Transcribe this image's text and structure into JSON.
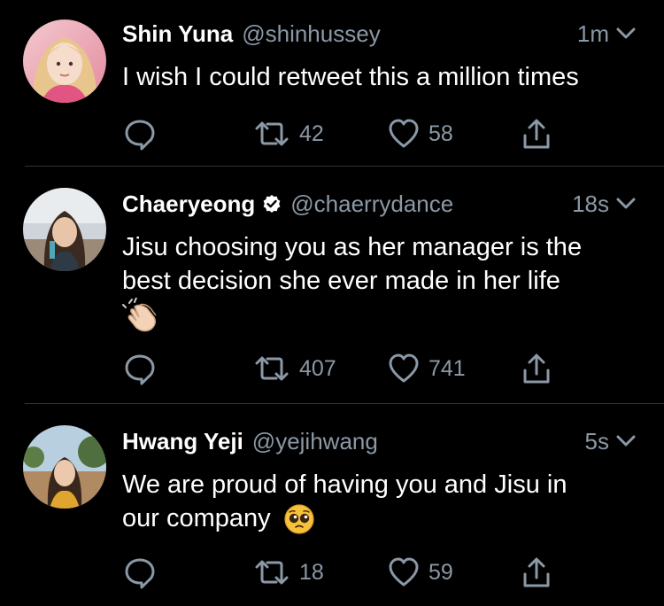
{
  "tweets": [
    {
      "name": "Shin Yuna",
      "handle": "@shinhussey",
      "time": "1m",
      "verified": false,
      "text": "I wish I could retweet this a million times",
      "retweets": "42",
      "likes": "58"
    },
    {
      "name": "Chaeryeong",
      "handle": "@chaerrydance",
      "time": "18s",
      "verified": true,
      "text_line1": "Jisu choosing you as her manager is the",
      "text_line2": "best decision she ever made in her life",
      "emoji": "clapping-hands",
      "retweets": "407",
      "likes": "741"
    },
    {
      "name": "Hwang Yeji",
      "handle": "@yejihwang",
      "time": "5s",
      "verified": false,
      "text_line1": "We are proud of having you and Jisu in",
      "text_line2": "our company",
      "emoji": "pleading-face",
      "retweets": "18",
      "likes": "59"
    }
  ],
  "colors": {
    "background": "#000000",
    "text": "#ffffff",
    "secondary": "#8b98a5",
    "divider": "#2f3336"
  }
}
